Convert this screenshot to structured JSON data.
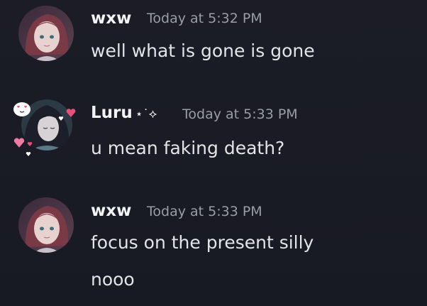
{
  "messages": [
    {
      "author": "wxw",
      "timestamp": "Today at 5:32 PM",
      "lines": [
        "well what is gone is gone"
      ]
    },
    {
      "author": "Luru",
      "author_decoration": "⋆˙⟡",
      "timestamp": "Today at 5:33 PM",
      "lines": [
        "u mean faking death?"
      ]
    },
    {
      "author": "wxw",
      "timestamp": "Today at 5:33 PM",
      "lines": [
        "focus on the present silly",
        "nooo"
      ]
    }
  ],
  "colors": {
    "background": "#1a1b25",
    "username": "#f2f3f5",
    "timestamp": "#9a9ca6",
    "message_text": "#e3e4e8",
    "heart": "#e8507a"
  },
  "icons": {
    "avatar_decoration": [
      "heart-eyes-bubble-icon",
      "pink-heart-icon"
    ]
  }
}
